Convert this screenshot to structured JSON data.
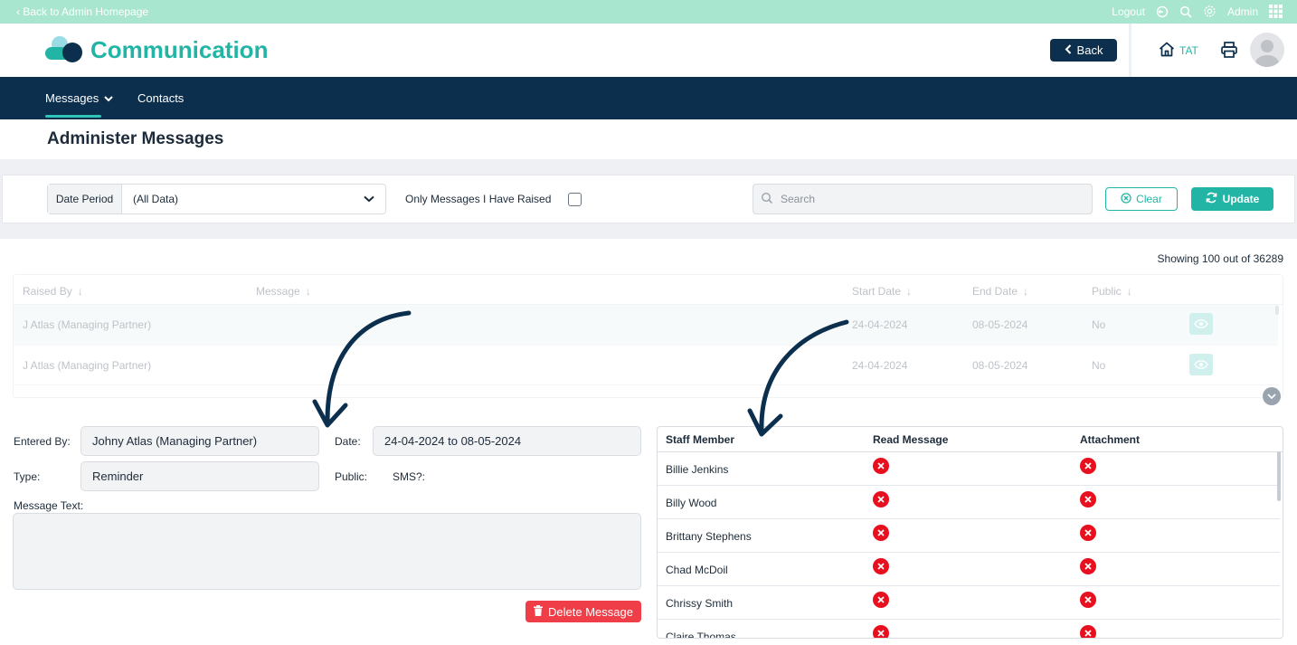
{
  "topbar": {
    "back_link": "‹ Back to Admin Homepage",
    "logout": "Logout",
    "user": "Admin"
  },
  "header": {
    "title": "Communication",
    "back_button": "Back",
    "home_label": "TAT"
  },
  "nav": {
    "items": [
      "Messages",
      "Contacts"
    ]
  },
  "page": {
    "title": "Administer Messages"
  },
  "filters": {
    "date_period_label": "Date Period",
    "date_period_value": "(All Data)",
    "only_mine_label": "Only Messages I Have Raised",
    "search_placeholder": "Search",
    "clear_button": "Clear",
    "update_button": "Update"
  },
  "results": {
    "showing": "Showing 100 out of 36289"
  },
  "messages_table": {
    "headers": [
      "Raised By",
      "Message",
      "Start Date",
      "End Date",
      "Public"
    ],
    "rows": [
      {
        "raised_by": "J Atlas (Managing Partner)",
        "message": "",
        "start": "24-04-2024",
        "end": "08-05-2024",
        "public": "No"
      },
      {
        "raised_by": "J Atlas (Managing Partner)",
        "message": "",
        "start": "24-04-2024",
        "end": "08-05-2024",
        "public": "No"
      }
    ]
  },
  "detail": {
    "entered_by_label": "Entered By:",
    "entered_by_value": "Johny Atlas (Managing Partner)",
    "date_label": "Date:",
    "date_value": "24-04-2024 to 08-05-2024",
    "type_label": "Type:",
    "type_value": "Reminder",
    "public_label": "Public:",
    "sms_label": "SMS?:",
    "message_text_label": "Message Text:",
    "delete_button": "Delete Message"
  },
  "staff_table": {
    "headers": [
      "Staff Member",
      "Read Message",
      "Attachment"
    ],
    "rows": [
      {
        "name": "Billie Jenkins"
      },
      {
        "name": "Billy Wood"
      },
      {
        "name": "Brittany Stephens"
      },
      {
        "name": "Chad McDoil"
      },
      {
        "name": "Chrissy Smith"
      },
      {
        "name": "Claire Thomas"
      }
    ]
  },
  "colors": {
    "brand_teal": "#22b5a6",
    "navy": "#0b2f4d",
    "topbar": "#a8e6cf",
    "danger": "#e8101f"
  }
}
